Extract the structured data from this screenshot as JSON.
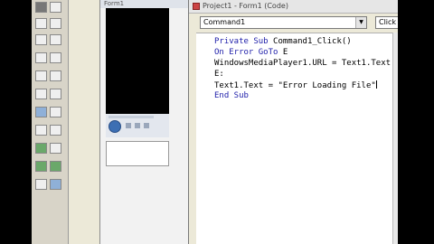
{
  "code_window": {
    "title": "Project1 - Form1 (Code)",
    "object_dropdown": "Command1",
    "procedure_dropdown": "Click",
    "lines": [
      {
        "kw": "Private Sub ",
        "rest": "Command1_Click()"
      },
      {
        "kw": "On Error GoTo ",
        "rest": "E"
      },
      {
        "kw": "",
        "rest": "WindowsMediaPlayer1.URL = Text1.Text"
      },
      {
        "kw": "",
        "rest": "E:"
      },
      {
        "kw": "",
        "rest": "Text1.Text = \"Error Loading File\""
      },
      {
        "kw": "End Sub",
        "rest": ""
      }
    ]
  },
  "form_window": {
    "title": "Form1"
  },
  "icons": {
    "dropdown_arrow": "chevron-down-icon",
    "play": "play-icon"
  }
}
